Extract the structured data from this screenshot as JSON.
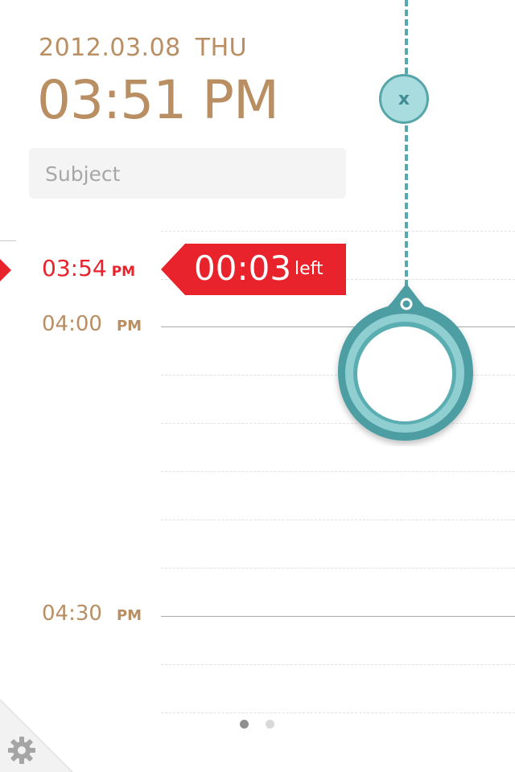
{
  "header": {
    "date": "2012.03.08",
    "day_of_week": "THU",
    "time": "03:51 PM"
  },
  "subject": {
    "placeholder": "Subject",
    "value": ""
  },
  "now_marker": {
    "time": "03:54",
    "ampm": "PM",
    "remaining": "00:03",
    "remaining_label": "left"
  },
  "timeline": {
    "labels": [
      {
        "time": "04:00",
        "ampm": "PM"
      },
      {
        "time": "04:30",
        "ampm": "PM"
      }
    ]
  },
  "alarm": {
    "close_label": "x"
  },
  "pager": {
    "pages": 2,
    "current": 1
  },
  "icons": {
    "settings": "gear-icon",
    "close": "close-icon",
    "ring": "ring-handle-icon"
  },
  "colors": {
    "accent_brown": "#b98e62",
    "accent_red": "#e8232b",
    "accent_teal": "#56a9ad"
  }
}
